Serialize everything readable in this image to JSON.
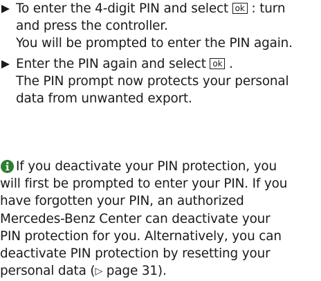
{
  "colors": {
    "text": "#1a1a1a",
    "info_icon": "#2d7d32",
    "background": "#ffffff"
  },
  "steps": [
    {
      "icon": "triangle-arrow-icon",
      "line1_pre": "To enter the 4-digit PIN and select ",
      "button": "ok",
      "line1_post": " : turn",
      "line2": "and press the controller.",
      "line3": "You will be prompted to enter the PIN again."
    },
    {
      "icon": "triangle-arrow-icon",
      "line1_pre": "Enter the PIN again and select ",
      "button": "ok",
      "line1_post": " .",
      "line2": "The PIN prompt now protects your personal",
      "line3": "data from unwanted export."
    }
  ],
  "note": {
    "icon": "info-icon",
    "lines": [
      "If you deactivate your PIN protection, you",
      "will first be prompted to enter your PIN. If you",
      "have forgotten your PIN, an authorized",
      "Mercedes-Benz Center can deactivate your",
      "PIN protection for you. Alternatively, you can",
      "deactivate PIN protection by resetting your"
    ],
    "last_line_pre": "personal data (",
    "page_ref_symbol": "▷",
    "page_ref": " page 31",
    "last_line_post": ")."
  }
}
